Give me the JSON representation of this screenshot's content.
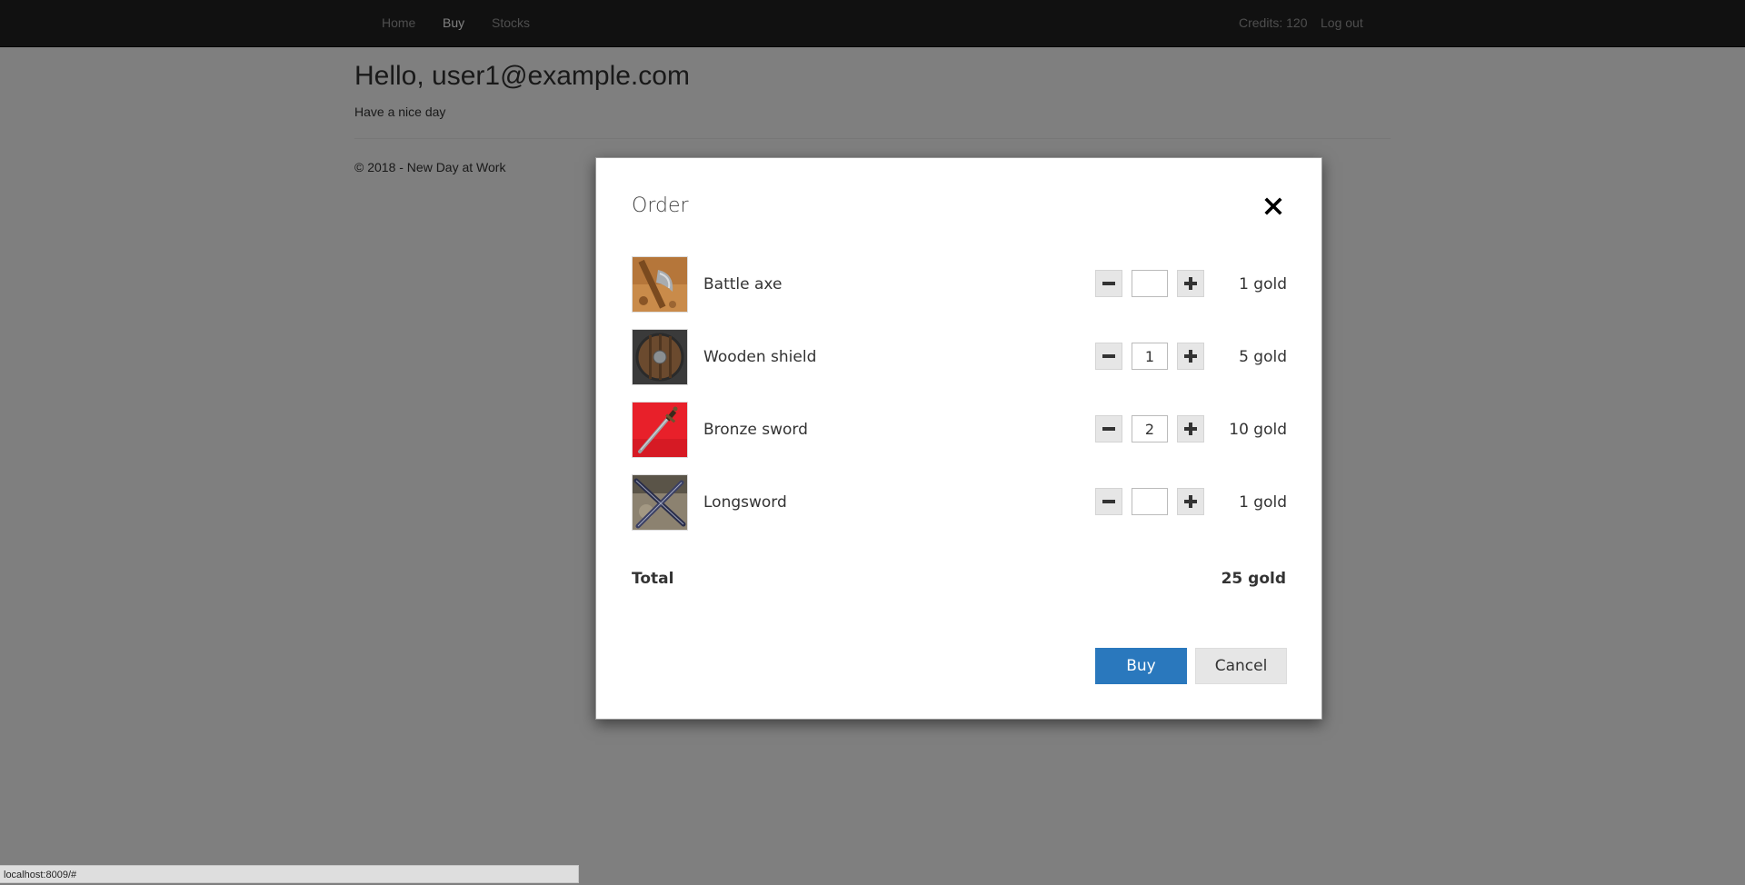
{
  "navbar": {
    "links": [
      {
        "label": "Home",
        "active": false
      },
      {
        "label": "Buy",
        "active": true
      },
      {
        "label": "Stocks",
        "active": false
      }
    ],
    "credits": "Credits: 120",
    "logout": "Log out"
  },
  "page": {
    "greeting": "Hello, user1@example.com",
    "subtitle": "Have a nice day",
    "footer": "© 2018 - New Day at Work"
  },
  "status_bar": {
    "url": "localhost:8009/#"
  },
  "modal": {
    "title": "Order",
    "close_icon": "close-icon",
    "items": [
      {
        "name": "Battle axe",
        "quantity": "",
        "price": "1 gold",
        "thumbnail": "battle-axe-thumbnail"
      },
      {
        "name": "Wooden shield",
        "quantity": "1",
        "price": "5 gold",
        "thumbnail": "wooden-shield-thumbnail"
      },
      {
        "name": "Bronze sword",
        "quantity": "2",
        "price": "10 gold",
        "thumbnail": "bronze-sword-thumbnail"
      },
      {
        "name": "Longsword",
        "quantity": "",
        "price": "1 gold",
        "thumbnail": "longsword-thumbnail"
      }
    ],
    "total_label": "Total",
    "total_value": "25 gold",
    "buy_label": "Buy",
    "cancel_label": "Cancel"
  },
  "colors": {
    "navbar_bg": "#222222",
    "overlay": "rgba(0,0,0,0.5)",
    "buy_button": "#2a78bd",
    "cancel_button": "#e6e6e6"
  }
}
